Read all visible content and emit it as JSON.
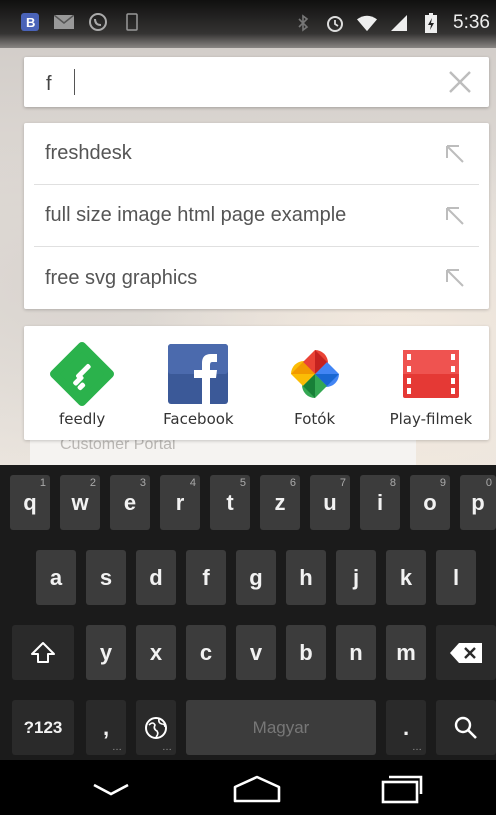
{
  "status_bar": {
    "time": "5:36",
    "left_icons": [
      "b-app-icon",
      "mail-icon",
      "whatsapp-icon",
      "phone-outline-icon"
    ],
    "right_icons": [
      "bluetooth-icon",
      "alarm-icon",
      "wifi-icon",
      "signal-icon",
      "battery-charging-icon"
    ]
  },
  "search": {
    "value": "f",
    "clear_icon": "close-icon"
  },
  "suggestions": [
    {
      "text": "freshdesk"
    },
    {
      "text": "full size image html page example"
    },
    {
      "text": "free svg graphics"
    }
  ],
  "apps": [
    {
      "label": "feedly",
      "icon": "feedly-icon",
      "color": "#2bb24c"
    },
    {
      "label": "Facebook",
      "icon": "facebook-icon",
      "color": "#3b5998"
    },
    {
      "label": "Fotók",
      "icon": "photos-pinwheel-icon",
      "color": "#fbbc05"
    },
    {
      "label": "Play-filmek",
      "icon": "play-movies-icon",
      "color": "#e53935"
    }
  ],
  "background_text": "Customer Portal",
  "keyboard": {
    "row1": [
      {
        "key": "q",
        "hint": "1"
      },
      {
        "key": "w",
        "hint": "2"
      },
      {
        "key": "e",
        "hint": "3"
      },
      {
        "key": "r",
        "hint": "4"
      },
      {
        "key": "t",
        "hint": "5"
      },
      {
        "key": "z",
        "hint": "6"
      },
      {
        "key": "u",
        "hint": "7"
      },
      {
        "key": "i",
        "hint": "8"
      },
      {
        "key": "o",
        "hint": "9"
      },
      {
        "key": "p",
        "hint": "0"
      }
    ],
    "row2": [
      "a",
      "s",
      "d",
      "f",
      "g",
      "h",
      "j",
      "k",
      "l"
    ],
    "row3": [
      "y",
      "x",
      "c",
      "v",
      "b",
      "n",
      "m"
    ],
    "symbols_label": "?123",
    "comma_label": ",",
    "space_label": "Magyar",
    "period_label": "."
  }
}
